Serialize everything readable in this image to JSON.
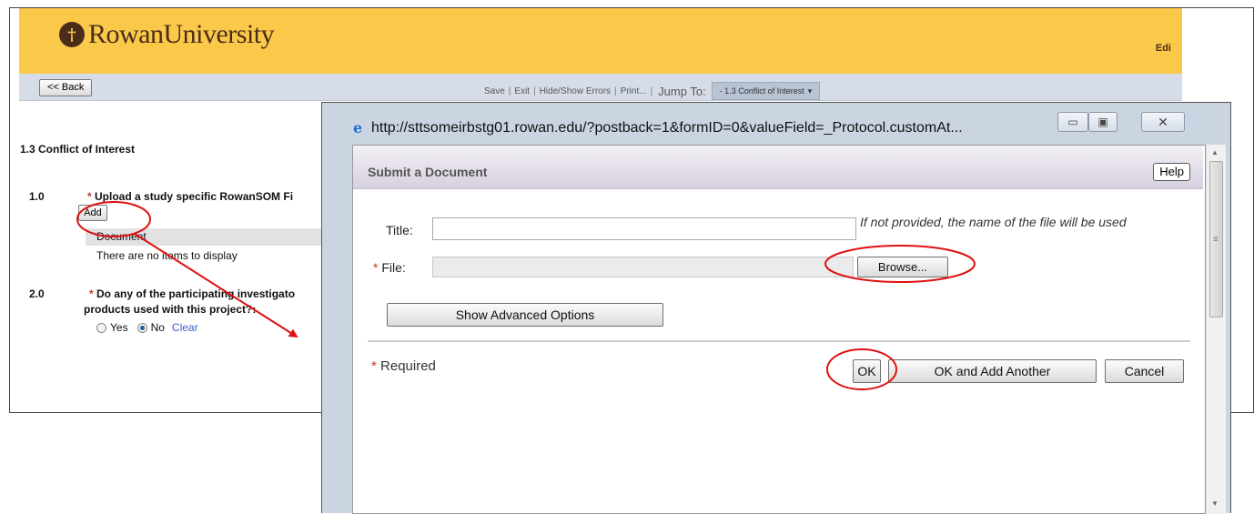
{
  "background_app": {
    "logo_text": "RowanUniversity",
    "logo_mark": "†",
    "logo_tm": "·",
    "edit_link": "Edi",
    "back_button": "<< Back",
    "toolbar": {
      "links": [
        "Save",
        "Exit",
        "Hide/Show Errors",
        "Print..."
      ],
      "jump_label": "Jump To:",
      "jump_value": "- 1.3 Conflict of Interest"
    },
    "section_title": "1.3 Conflict of Interest",
    "q1": {
      "number": "1.0",
      "star": "*",
      "text": "Upload a study specific RowanSOM Fi",
      "add_button": "Add",
      "doc_column": "Document",
      "empty_text": "There are no items to display"
    },
    "q2": {
      "number": "2.0",
      "star": "*",
      "text_line1": "Do any of the participating investigato",
      "text_line2": "products used with this project?:",
      "options": [
        "Yes",
        "No"
      ],
      "selected": "No",
      "clear_link": "Clear"
    }
  },
  "popup": {
    "url": "http://sttsomeirbstg01.rowan.edu/?postback=1&formID=0&valueField=_Protocol.customAt...",
    "dialog_title": "Submit a Document",
    "help_button": "Help",
    "title_label": "Title:",
    "title_value": "",
    "title_hint": "If not provided, the name of the file will be used",
    "file_star": "*",
    "file_label": "File:",
    "file_value": "",
    "browse_button": "Browse...",
    "advanced_button": "Show Advanced Options",
    "required_star": "*",
    "required_note": "Required",
    "ok_button": "OK",
    "ok_another_button": "OK and Add Another",
    "cancel_button": "Cancel"
  },
  "colors": {
    "header_gold": "#fbc94a",
    "annotation_red": "#e01010",
    "required_red": "#c0392b",
    "link_blue": "#3a5fcd"
  },
  "icons": {
    "browser": "ie-icon",
    "minimize": "minimize-icon",
    "maximize": "maximize-icon",
    "close": "close-icon"
  }
}
